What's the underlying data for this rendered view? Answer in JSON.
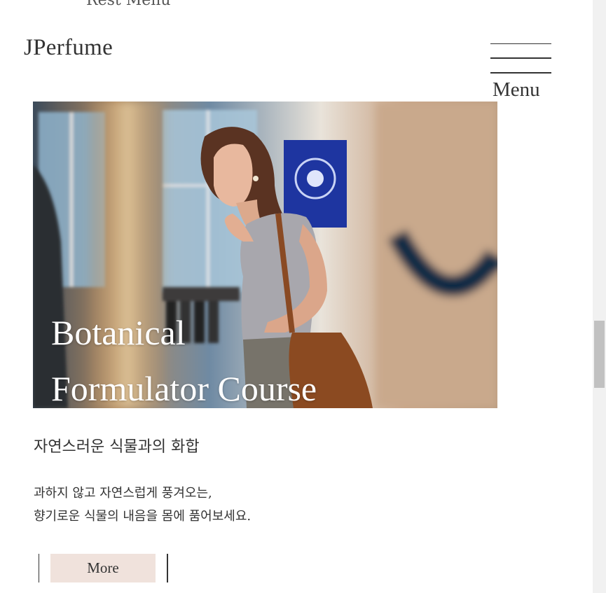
{
  "header": {
    "top_cut_text": "Rest Menu",
    "logo": "JPerfume",
    "menu_label": "Menu"
  },
  "hero": {
    "title_line1": "Botanical",
    "title_line2": "Formulator Course"
  },
  "content": {
    "subtitle": "자연스러운 식물과의 화합",
    "desc_line1": "과하지 않고 자연스럽게 풍겨오는,",
    "desc_line2": "향기로운 식물의 내음을 몸에 품어보세요.",
    "more_label": "More"
  },
  "colors": {
    "text": "#333333",
    "more_button_bg": "#f0e2dc",
    "hero_title": "#ffffff"
  }
}
